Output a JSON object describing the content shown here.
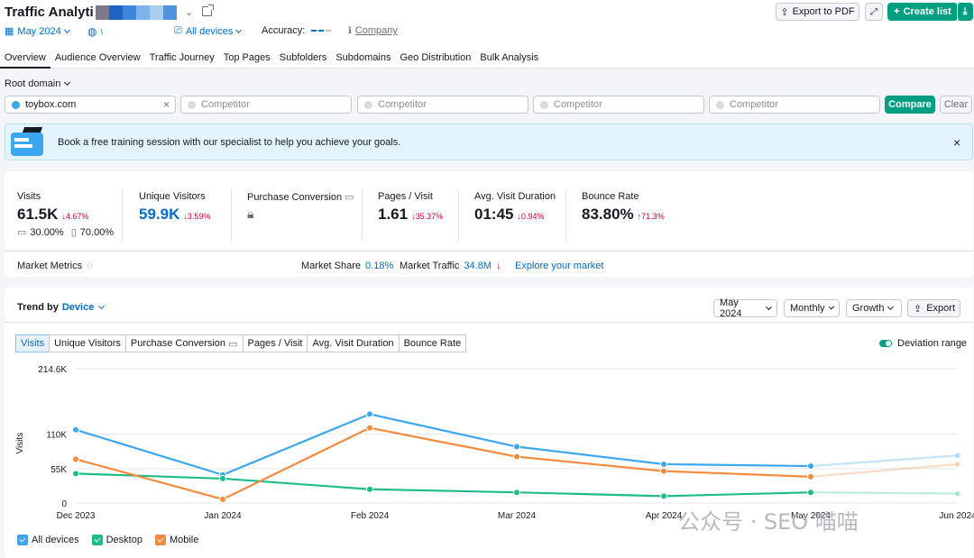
{
  "header": {
    "title": "Traffic Analyti",
    "period": "May 2024",
    "devices": "All devices",
    "accuracy_label": "Accuracy:",
    "company_label": "Company",
    "export_pdf": "Export to PDF",
    "create_list": "Create list"
  },
  "tabs": [
    "Overview",
    "Audience Overview",
    "Traffic Journey",
    "Top Pages",
    "Subfolders",
    "Subdomains",
    "Geo Distribution",
    "Bulk Analysis"
  ],
  "filter": {
    "root_domain": "Root domain",
    "domain_value": "toybox.com",
    "competitor_placeholder": "Competitor",
    "compare": "Compare",
    "clear": "Clear"
  },
  "banner": {
    "text": "Book a free training session with our specialist to help you achieve your goals."
  },
  "metrics": {
    "visits": {
      "label": "Visits",
      "value": "61.5K",
      "delta": "4.67%",
      "desktop": "30.00%",
      "mobile": "70.00%"
    },
    "unique": {
      "label": "Unique Visitors",
      "value": "59.9K",
      "delta": "3.59%"
    },
    "purchase": {
      "label": "Purchase Conversion"
    },
    "pages": {
      "label": "Pages / Visit",
      "value": "1.61",
      "delta": "35.37%"
    },
    "duration": {
      "label": "Avg. Visit Duration",
      "value": "01:45",
      "delta": "0.94%"
    },
    "bounce": {
      "label": "Bounce Rate",
      "value": "83.80%",
      "delta": "71.3%"
    }
  },
  "market": {
    "label": "Market Metrics",
    "share_label": "Market Share",
    "share_value": "0.18%",
    "traffic_label": "Market Traffic",
    "traffic_value": "34.8M",
    "explore": "Explore your market"
  },
  "trend": {
    "title": "Trend by",
    "device": "Device",
    "period_select": "May 2024",
    "granularity": "Monthly",
    "mode": "Growth",
    "export": "Export",
    "deviation": "Deviation range",
    "metric_tabs": [
      "Visits",
      "Unique Visitors",
      "Purchase Conversion",
      "Pages / Visit",
      "Avg. Visit Duration",
      "Bounce Rate"
    ]
  },
  "watermark": "公众号 · SEO 喵喵",
  "colors": {
    "all": "#3aa7f0",
    "desktop": "#1ebc8a",
    "mobile": "#f48a3d",
    "green": "#009f81",
    "blue": "#006dca"
  },
  "chart_data": {
    "type": "line",
    "categories": [
      "Dec 2023",
      "Jan 2024",
      "Feb 2024",
      "Mar 2024",
      "Apr 2024",
      "May 2024",
      "Jun 2024"
    ],
    "ylabel": "Visits",
    "ylim": [
      0,
      214600
    ],
    "y_ticks": [
      "0",
      "55K",
      "110K",
      "214.6K"
    ],
    "y_tick_values": [
      0,
      55000,
      110000,
      214600
    ],
    "series": [
      {
        "name": "All devices",
        "color": "#3aa7f0",
        "values": [
          117000,
          45000,
          142000,
          90000,
          62000,
          59000,
          76000
        ]
      },
      {
        "name": "Desktop",
        "color": "#1ebc8a",
        "values": [
          47000,
          39000,
          22000,
          17000,
          11000,
          17000,
          15000
        ]
      },
      {
        "name": "Mobile",
        "color": "#f48a3d",
        "values": [
          70000,
          6000,
          120000,
          74000,
          51000,
          42000,
          62000
        ]
      }
    ],
    "forecast_from_index": 5,
    "grid": true,
    "legend": "bottom-left"
  }
}
